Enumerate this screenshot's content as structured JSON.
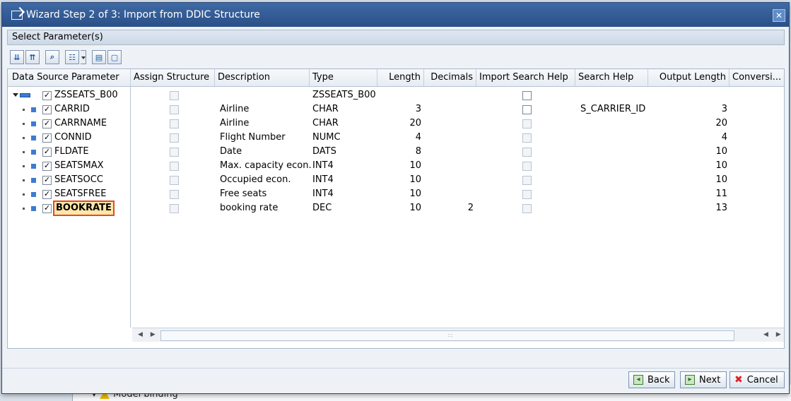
{
  "backdrop": {
    "text": "Model binding"
  },
  "dialog": {
    "title": "Wizard Step 2 of 3: Import from DDIC Structure",
    "section_title": "Select Parameter(s)",
    "close_glyph": "✕"
  },
  "toolbar": {
    "buttons": [
      "expand-all-icon",
      "collapse-all-icon",
      "find-icon",
      "layout-icon",
      "select-all-icon",
      "deselect-all-icon"
    ]
  },
  "columns": [
    "Data Source Parameter",
    "Assign Structure",
    "Description",
    "Type",
    "Length",
    "Decimals",
    "Import Search Help",
    "Search Help",
    "Output Length",
    "Conversi..."
  ],
  "root": {
    "name": "ZSSEATS_B00",
    "type": "ZSSEATS_B00"
  },
  "rows": [
    {
      "name": "CARRID",
      "description": "Airline",
      "type": "CHAR",
      "length": "3",
      "decimals": "",
      "search_help": "S_CARRIER_ID",
      "output_length": "3"
    },
    {
      "name": "CARRNAME",
      "description": "Airline",
      "type": "CHAR",
      "length": "20",
      "decimals": "",
      "search_help": "",
      "output_length": "20"
    },
    {
      "name": "CONNID",
      "description": "Flight Number",
      "type": "NUMC",
      "length": "4",
      "decimals": "",
      "search_help": "",
      "output_length": "4"
    },
    {
      "name": "FLDATE",
      "description": "Date",
      "type": "DATS",
      "length": "8",
      "decimals": "",
      "search_help": "",
      "output_length": "10"
    },
    {
      "name": "SEATSMAX",
      "description": "Max. capacity econ.",
      "type": "INT4",
      "length": "10",
      "decimals": "",
      "search_help": "",
      "output_length": "10"
    },
    {
      "name": "SEATSOCC",
      "description": "Occupied econ.",
      "type": "INT4",
      "length": "10",
      "decimals": "",
      "search_help": "",
      "output_length": "10"
    },
    {
      "name": "SEATSFREE",
      "description": "Free seats",
      "type": "INT4",
      "length": "10",
      "decimals": "",
      "search_help": "",
      "output_length": "11"
    },
    {
      "name": "BOOKRATE",
      "description": "booking rate",
      "type": "DEC",
      "length": "10",
      "decimals": "2",
      "search_help": "",
      "output_length": "13"
    }
  ],
  "footer": {
    "back": "Back",
    "next": "Next",
    "cancel": "Cancel"
  },
  "colors": {
    "title_bg": "#2a4f87",
    "selection_outline": "#e04a2a",
    "selection_bg": "#ffe7a8"
  }
}
